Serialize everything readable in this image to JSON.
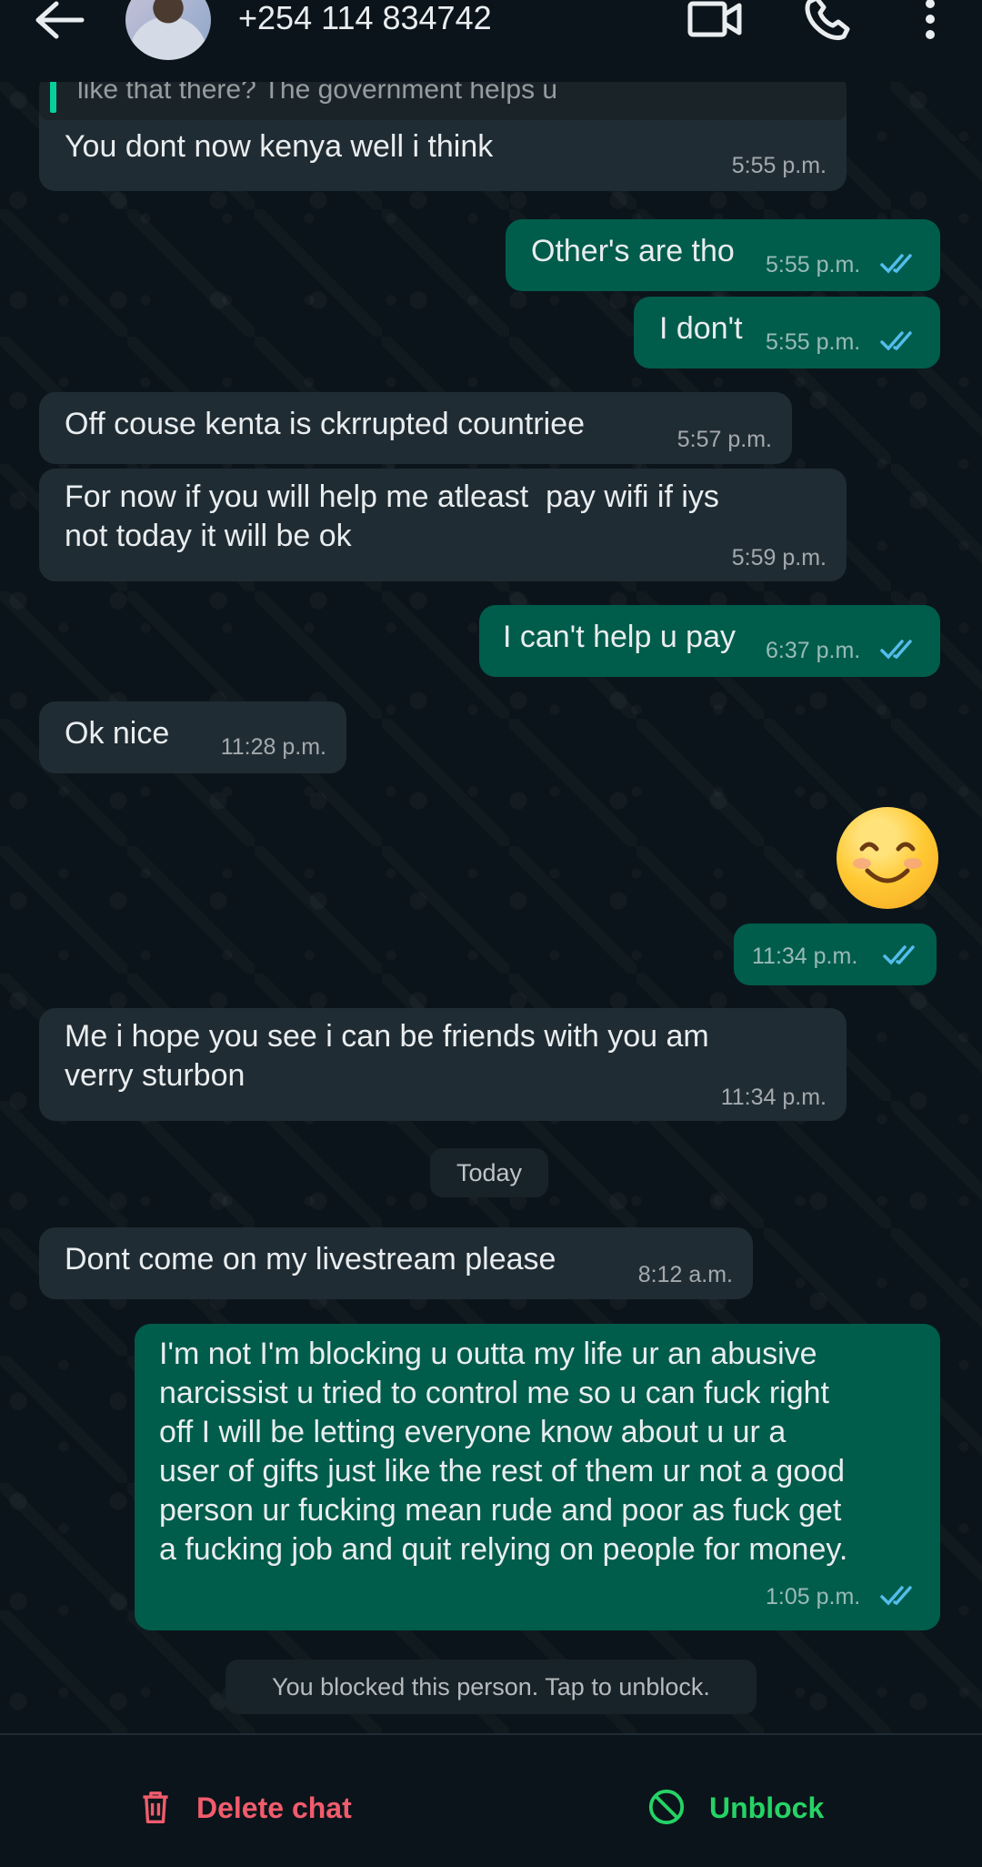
{
  "header": {
    "contact_name": "+254 114 834742",
    "icons": [
      "back-arrow-icon",
      "video-call-icon",
      "phone-icon",
      "more-vert-icon"
    ]
  },
  "messages": [
    {
      "dir": "in",
      "quote": "like that there? The government helps u",
      "text": "You dont now kenya well i think",
      "time": "5:55 p.m."
    },
    {
      "dir": "out",
      "text": "Other's are tho",
      "time": "5:55 p.m.",
      "status": "read"
    },
    {
      "dir": "out",
      "text": "I don't",
      "time": "5:55 p.m.",
      "status": "read"
    },
    {
      "dir": "in",
      "text": "Off couse kenta is ckrrupted countriee",
      "time": "5:57 p.m."
    },
    {
      "dir": "in",
      "text": "For now if you will help me atleast  pay wifi if iys\nnot today it will be ok",
      "time": "5:59 p.m."
    },
    {
      "dir": "out",
      "text": "I can't help u pay",
      "time": "6:37 p.m.",
      "status": "read"
    },
    {
      "dir": "in",
      "text": "Ok nice",
      "time": "11:28 p.m."
    },
    {
      "dir": "out",
      "emoji": "smiling-face-icon",
      "time": "11:34 p.m.",
      "status": "read"
    },
    {
      "dir": "in",
      "text": "Me i hope you see i can be friends with you am\nverry sturbon",
      "time": "11:34 p.m."
    },
    {
      "dir": "in",
      "text": "Dont come on my livestream please",
      "time": "8:12 a.m."
    },
    {
      "dir": "out",
      "text": "I'm not I'm blocking u outta my life ur an abusive\nnarcissist u tried to control me so u can fuck right\noff I will be letting everyone know about u ur a\nuser of gifts just like the rest of them ur not a good\nperson ur fucking mean rude and poor as fuck get\na fucking job and quit relying on people for money.",
      "time": "1:05 p.m.",
      "status": "read"
    }
  ],
  "day_divider": "Today",
  "system_notice": "You blocked this person. Tap to unblock.",
  "actions": {
    "delete_label": "Delete chat",
    "unblock_label": "Unblock"
  },
  "colors": {
    "background": "#0b141a",
    "incoming_bubble": "#202c33",
    "outgoing_bubble": "#005c4b",
    "read_ticks": "#53bdeb",
    "delete": "#f15c6d",
    "unblock": "#25d366"
  }
}
